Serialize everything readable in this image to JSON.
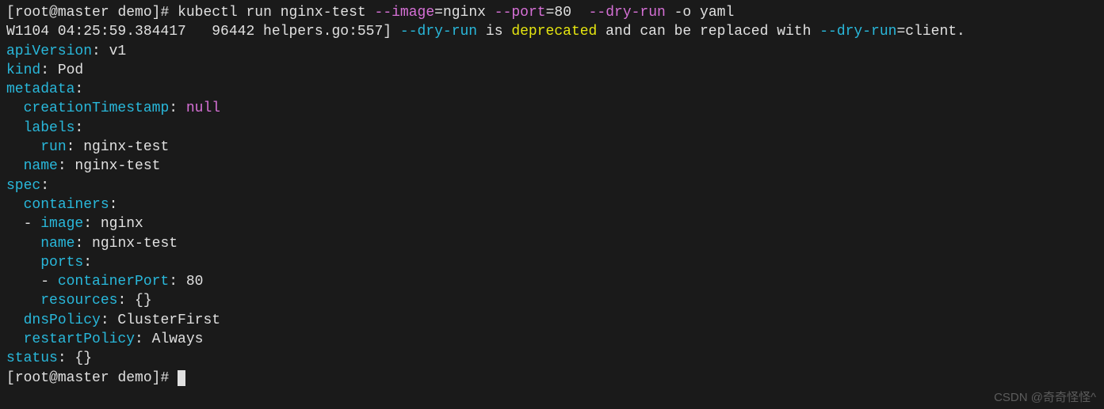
{
  "prompt1": {
    "bracket_open": "[",
    "user": "root@master",
    "dir": " demo",
    "bracket_close": "]",
    "hash": "# ",
    "cmd_start": "kubectl run nginx-test ",
    "flag_image": "--image",
    "eq_nginx": "=nginx ",
    "flag_port": "--port",
    "eq_80": "=80  ",
    "flag_dryrun": "--dry-run",
    "space_o": " -o yaml"
  },
  "warn": {
    "prefix": "W1104 04:25:59.384417   96442 helpers.go:557] ",
    "flag": "--dry-run",
    "mid1": " is ",
    "deprecated": "deprecated",
    "mid2": " and can be replaced with ",
    "flag2": "--dry-run",
    "suffix": "=client."
  },
  "yaml": {
    "k_apiVersion": "apiVersion",
    "v_apiVersion": ": v1",
    "k_kind": "kind",
    "v_kind": ": Pod",
    "k_metadata": "metadata",
    "colon": ":",
    "k_creationTimestamp": "creationTimestamp",
    "v_null": "null",
    "k_labels": "labels",
    "k_run": "run",
    "v_run": ": nginx-test",
    "k_name": "name",
    "v_name": ": nginx-test",
    "k_spec": "spec",
    "k_containers": "containers",
    "k_image": "image",
    "v_image": ": nginx",
    "k_name2": "name",
    "v_name2": ": nginx-test",
    "k_ports": "ports",
    "k_containerPort": "containerPort",
    "v_containerPort": ": 80",
    "k_resources": "resources",
    "v_resources": ": {}",
    "k_dnsPolicy": "dnsPolicy",
    "v_dnsPolicy": ": ClusterFirst",
    "k_restartPolicy": "restartPolicy",
    "v_restartPolicy": ": Always",
    "k_status": "status",
    "v_status": ": {}"
  },
  "prompt2": {
    "bracket_open": "[",
    "user": "root@master",
    "dir": " demo",
    "bracket_close": "]",
    "hash": "# "
  },
  "watermark": "CSDN @奇奇怪怪^"
}
